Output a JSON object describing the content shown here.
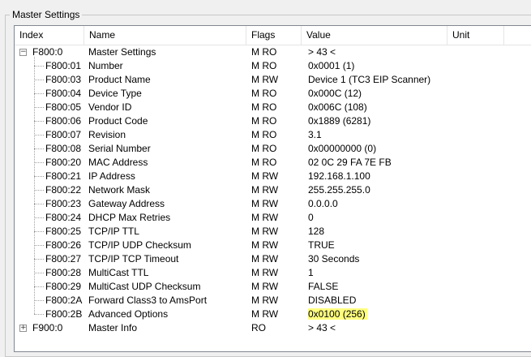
{
  "group": {
    "title": "Master Settings"
  },
  "columns": {
    "index": "Index",
    "name": "Name",
    "flags": "Flags",
    "value": "Value",
    "unit": "Unit"
  },
  "rows": [
    {
      "index": "F800:0",
      "name": "Master Settings",
      "flags": "M RO",
      "value": "> 43 <",
      "level": 0,
      "expander": "−"
    },
    {
      "index": "F800:01",
      "name": "Number",
      "flags": "M RO",
      "value": "0x0001 (1)",
      "level": 1
    },
    {
      "index": "F800:03",
      "name": "Product Name",
      "flags": "M RW",
      "value": "Device 1 (TC3 EIP Scanner)",
      "level": 1
    },
    {
      "index": "F800:04",
      "name": "Device Type",
      "flags": "M RO",
      "value": "0x000C (12)",
      "level": 1
    },
    {
      "index": "F800:05",
      "name": "Vendor ID",
      "flags": "M RO",
      "value": "0x006C (108)",
      "level": 1
    },
    {
      "index": "F800:06",
      "name": "Product Code",
      "flags": "M RO",
      "value": "0x1889 (6281)",
      "level": 1
    },
    {
      "index": "F800:07",
      "name": "Revision",
      "flags": "M RO",
      "value": "3.1",
      "level": 1
    },
    {
      "index": "F800:08",
      "name": "Serial Number",
      "flags": "M RO",
      "value": "0x00000000 (0)",
      "level": 1
    },
    {
      "index": "F800:20",
      "name": "MAC Address",
      "flags": "M RO",
      "value": "02 0C 29 FA 7E FB",
      "level": 1
    },
    {
      "index": "F800:21",
      "name": "IP Address",
      "flags": "M RW",
      "value": "192.168.1.100",
      "level": 1
    },
    {
      "index": "F800:22",
      "name": "Network Mask",
      "flags": "M RW",
      "value": "255.255.255.0",
      "level": 1
    },
    {
      "index": "F800:23",
      "name": "Gateway Address",
      "flags": "M RW",
      "value": "0.0.0.0",
      "level": 1
    },
    {
      "index": "F800:24",
      "name": "DHCP Max Retries",
      "flags": "M RW",
      "value": "0",
      "level": 1
    },
    {
      "index": "F800:25",
      "name": "TCP/IP TTL",
      "flags": "M RW",
      "value": "128",
      "level": 1
    },
    {
      "index": "F800:26",
      "name": "TCP/IP UDP Checksum",
      "flags": "M RW",
      "value": "TRUE",
      "level": 1
    },
    {
      "index": "F800:27",
      "name": "TCP/IP TCP Timeout",
      "flags": "M RW",
      "value": "30 Seconds",
      "level": 1
    },
    {
      "index": "F800:28",
      "name": "MultiCast TTL",
      "flags": "M RW",
      "value": "1",
      "level": 1
    },
    {
      "index": "F800:29",
      "name": "MultiCast UDP Checksum",
      "flags": "M RW",
      "value": "FALSE",
      "level": 1
    },
    {
      "index": "F800:2A",
      "name": "Forward Class3 to AmsPort",
      "flags": "M RW",
      "value": "DISABLED",
      "level": 1
    },
    {
      "index": "F800:2B",
      "name": "Advanced Options",
      "flags": "M RW",
      "value": "0x0100 (256)",
      "level": 1,
      "highlight": true
    },
    {
      "index": "F900:0",
      "name": "Master Info",
      "flags": "RO",
      "value": "> 43 <",
      "level": 0,
      "expander": "+"
    }
  ],
  "colors": {
    "highlight": "#ffff7f",
    "border": "#828790",
    "header_divider": "#e5e5e5"
  }
}
